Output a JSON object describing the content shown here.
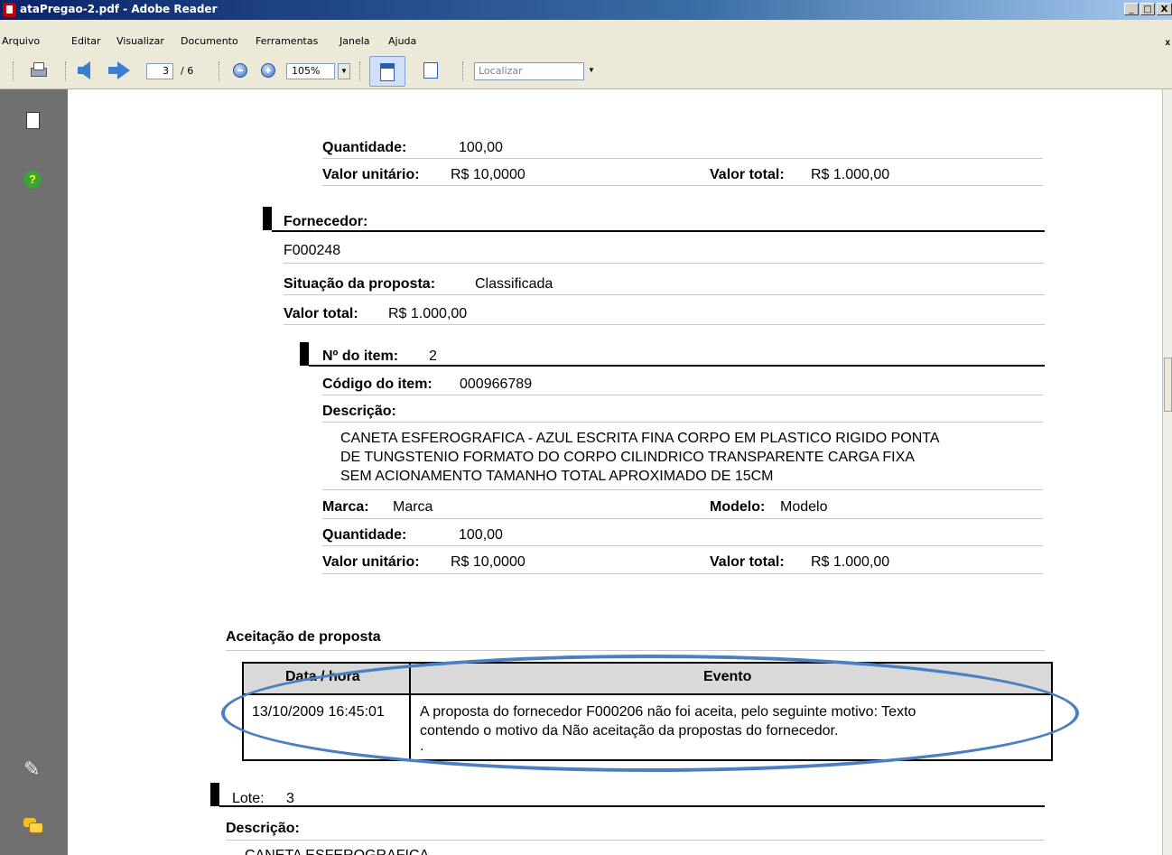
{
  "window": {
    "title": "ataPregao-2.pdf - Adobe Reader",
    "min": "_",
    "max": "□",
    "close": "X"
  },
  "menu": {
    "items": [
      "Arquivo",
      "Editar",
      "Visualizar",
      "Documento",
      "Ferramentas",
      "Janela",
      "Ajuda"
    ],
    "close": "x"
  },
  "toolbar": {
    "page": "3",
    "page_total": "/ 6",
    "zoom": "105%",
    "find_placeholder": "Localizar"
  },
  "doc": {
    "qtd_label": "Quantidade:",
    "qtd_value": "100,00",
    "vu_label": "Valor unitário:",
    "vu_value": "R$ 10,0000",
    "vt_label": "Valor total:",
    "vt_value": "R$ 1.000,00",
    "fornecedor_label": "Fornecedor:",
    "fornecedor_value": "F000248",
    "situacao_label": "Situação da proposta:",
    "situacao_value": "Classificada",
    "valor_total_label": "Valor total:",
    "valor_total_value": "R$ 1.000,00",
    "item_label": "Nº do item:",
    "item_value": "2",
    "codigo_label": "Código do item:",
    "codigo_value": "000966789",
    "descricao_label": "Descrição:",
    "descricao_lines": [
      "CANETA ESFEROGRAFICA -  AZUL ESCRITA FINA CORPO EM PLASTICO RIGIDO PONTA",
      "DE TUNGSTENIO FORMATO DO CORPO CILINDRICO  TRANSPARENTE CARGA FIXA",
      "SEM ACIONAMENTO TAMANHO TOTAL APROXIMADO DE 15CM"
    ],
    "marca_label": "Marca:",
    "marca_value": "Marca",
    "modelo_label": "Modelo:",
    "modelo_value": "Modelo",
    "qtd2_label": "Quantidade:",
    "qtd2_value": "100,00",
    "vu2_label": "Valor unitário:",
    "vu2_value": "R$ 10,0000",
    "vt2_label": "Valor total:",
    "vt2_value": "R$ 1.000,00",
    "aceitacao_title": "Aceitação de proposta",
    "table": {
      "col1": "Data / hora",
      "col2": "Evento",
      "row_date": "13/10/2009 16:45:01",
      "row_event_lines": [
        "A proposta do fornecedor F000206 não foi aceita, pelo seguinte motivo: Texto",
        "contendo o motivo da Não aceitação da propostas do fornecedor.",
        "."
      ]
    },
    "lote_label": "Lote:",
    "lote_value": "3",
    "descricao2_label": "Descrição:",
    "descricao2_partial": "CANETA ESFEROGRAFICA"
  }
}
